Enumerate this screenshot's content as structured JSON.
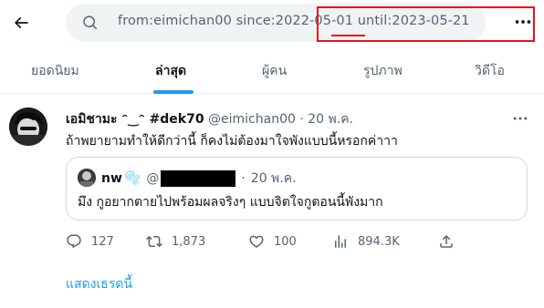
{
  "search": {
    "query": "from:eimichan00 since:2022-05-01 until:2023-05-21"
  },
  "tabs": [
    {
      "label": "ยอดนิยม",
      "active": false
    },
    {
      "label": "ล่าสุด",
      "active": true
    },
    {
      "label": "ผู้คน",
      "active": false
    },
    {
      "label": "รูปภาพ",
      "active": false
    },
    {
      "label": "วิดีโอ",
      "active": false
    }
  ],
  "tweet": {
    "display_name": "เอมิชามะ ᵔ‿ᵔ #dek70",
    "handle": "@eimichan00",
    "dot": "·",
    "time": "20 พ.ค.",
    "text": "ถ้าพยายามทำให้ดีกว่านี้ ก็คงไม่ต้องมาใจพังแบบนี้หรอกค่าาา",
    "quote": {
      "name": "nw",
      "emoji": "🫧",
      "at": "@",
      "dot": "·",
      "time": "20 พ.ค.",
      "text": "มึง กูอยากตายไปพร้อมผลจริงๆ แบบจิตใจกูตอนนี้พังมาก"
    },
    "stats": {
      "replies": "127",
      "retweets": "1,873",
      "likes": "100",
      "views": "894.3K"
    },
    "show_thread": "แสดงเธรดนี้"
  },
  "colors": {
    "accent": "#1d9bf0",
    "highlight": "#e8121b",
    "secondary_text": "#536471"
  },
  "icons": {
    "back": "arrow-left-icon",
    "search": "search-icon",
    "more": "more-icon",
    "reply": "reply-icon",
    "retweet": "retweet-icon",
    "like": "heart-icon",
    "views": "views-icon",
    "share": "share-icon"
  }
}
